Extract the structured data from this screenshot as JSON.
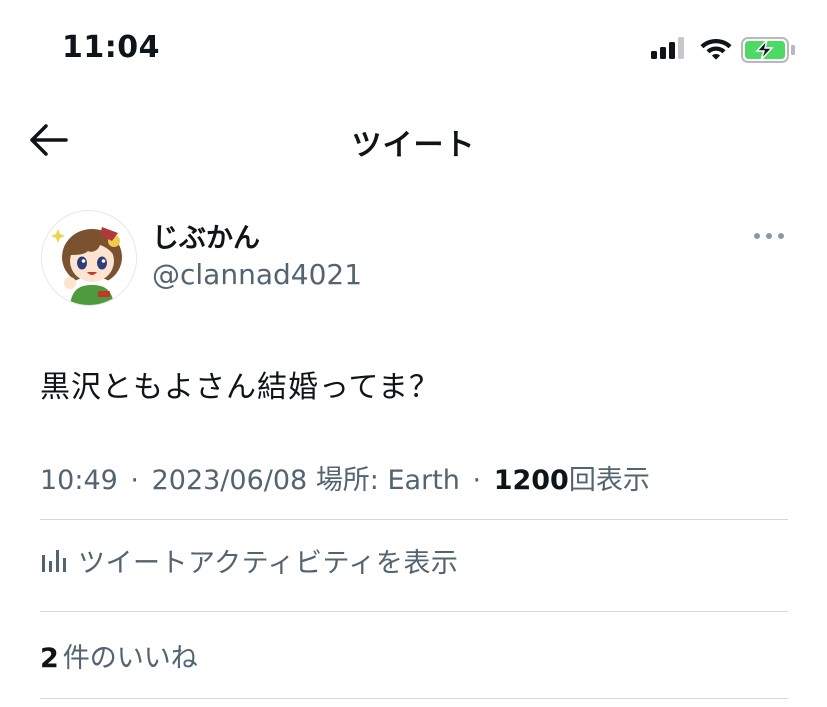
{
  "status_bar": {
    "time": "11:04",
    "icons": [
      "signal-icon",
      "wifi-icon",
      "battery-charging-icon"
    ],
    "battery_color": "#4cd964"
  },
  "header": {
    "back_icon": "arrow-left-icon",
    "title": "ツイート"
  },
  "author": {
    "display_name": "じぶかん",
    "handle": "@clannad4021",
    "avatar": "anime-girl-avatar",
    "more_icon": "more-horizontal-icon"
  },
  "tweet": {
    "text": "黒沢ともよさん結婚ってま？",
    "time": "10:49",
    "date": "2023/06/08",
    "location": "場所: Earth",
    "separator": "·",
    "views_count": "1200",
    "views_label": "回表示"
  },
  "activity": {
    "icon": "bar-chart-icon",
    "label": "ツイートアクティビティを表示"
  },
  "likes": {
    "count": "2",
    "label": "件のいいね"
  },
  "colors": {
    "text_primary": "#0f1419",
    "text_secondary": "#536471",
    "divider": "#cfd9de"
  }
}
